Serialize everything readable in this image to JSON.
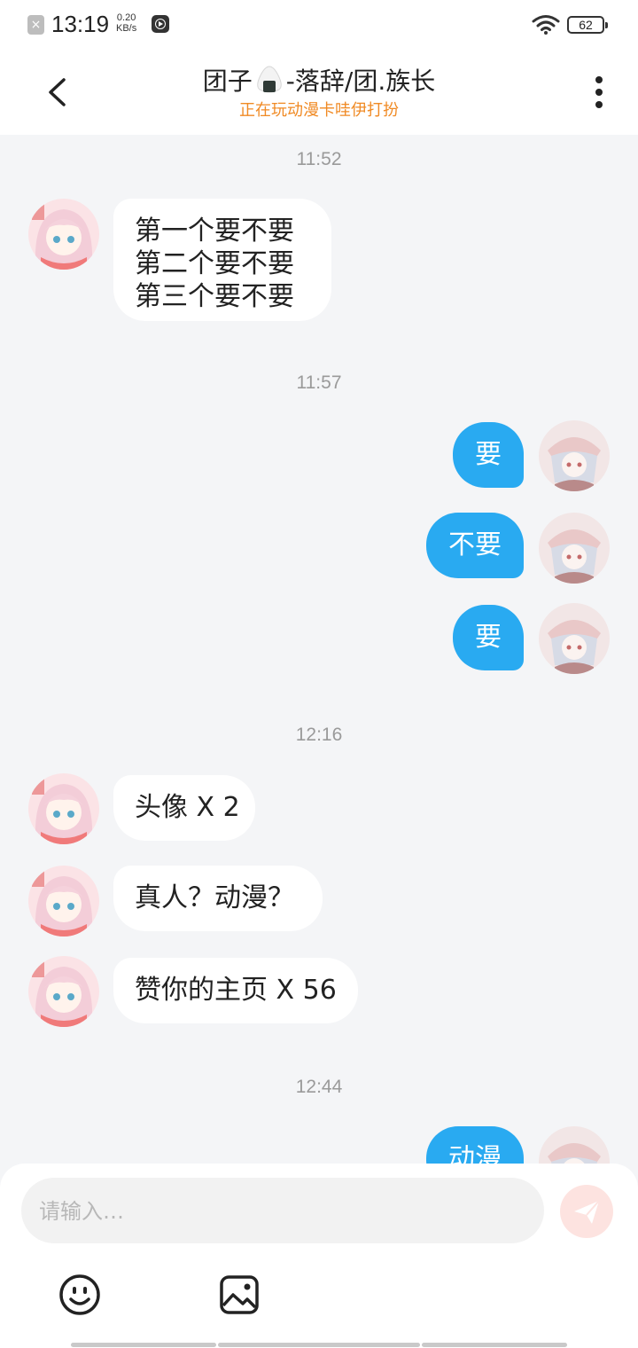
{
  "status_bar": {
    "time": "13:19",
    "net_speed_value": "0.20",
    "net_speed_unit": "KB/s",
    "battery": "62",
    "notify_icon": "close-box-icon",
    "media_icon": "play-icon",
    "wifi_icon": "wifi-icon"
  },
  "header": {
    "title_name": "团子",
    "title_suffix": "-落辞/团.族长",
    "subtitle": "正在玩动漫卡哇伊打扮",
    "back_icon": "back-chevron-icon",
    "more_icon": "more-vertical-icon"
  },
  "colors": {
    "accent_blue": "#29aaf1",
    "subtitle_orange": "#f08a24",
    "send_button_pink": "#fde3e0"
  },
  "messages": {
    "ts1": "11:52",
    "m1": {
      "line1": "第一个要不要",
      "line2": "第二个要不要",
      "line3": "第三个要不要"
    },
    "ts2": "11:57",
    "m2": "要",
    "m3": "不要",
    "m4": "要",
    "ts3": "12:16",
    "m5": "头像 X 2",
    "m6": "真人？动漫？",
    "m7": "赞你的主页 X 56",
    "ts4": "12:44",
    "m8": "动漫"
  },
  "composer": {
    "placeholder": "请输入…",
    "send_icon": "send-icon",
    "emoji_icon": "emoji-icon",
    "image_icon": "image-icon"
  }
}
